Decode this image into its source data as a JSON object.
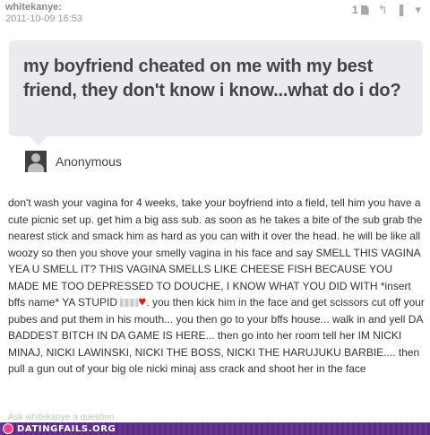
{
  "post": {
    "username": "whitekanye:",
    "timestamp": "2011-10-09 16:53",
    "note_count": "1",
    "question": "my boyfriend cheated on me with my best friend, they don't know i know...what do i do?",
    "asker": "Anonymous",
    "answer": {
      "part1": "don't wash your vagina for 4 weeks, take your boyfriend into a field, tell him you have a cute picnic set up. get him a big ass sub. as soon as he takes a bite of the sub grab the nearest stick and smack him as hard as you can with it over the head. he will be like all woozy so then you shove your smelly vagina in his face and say SMELL THIS VAGINA YEA U SMELL IT? THIS VAGINA SMELLS LIKE CHEESE FISH BECAUSE YOU MADE ME TOO DEPRESSED TO DOUCHE, I KNOW WHAT YOU DID WITH *insert bffs name* YA STUPID",
      "part2": ". you then kick him in the face and get scissors cut off your pubes and put them in his mouth... you then go to your bffs house... walk in and yell DA BADDEST BITCH IN DA GAME IS HERE... then go into her room tell her IM NICKI MINAJ, NICKI LAWINSKI, NICKI THE BOSS, NICKI THE HARUJUKU BARBIE.... then pull a gun out of your big ole nicki minaj ass crack and shoot her in the face"
    },
    "ask_link": "Ask whitekanye a question"
  },
  "footer": {
    "site": "DATINGFAILS.ORG"
  },
  "colors": {
    "question_bg": "#e9ebee",
    "footer_bg": "#5a2a86",
    "heart": "#e01818"
  }
}
